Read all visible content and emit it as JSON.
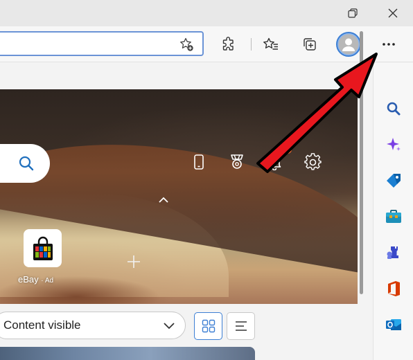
{
  "window_controls": {
    "restore": "restore-icon",
    "close": "close-icon"
  },
  "toolbar": {
    "address_value": "",
    "icons": [
      "add-favorite-icon",
      "extensions-icon",
      "favorites-icon",
      "collections-icon",
      "profile-avatar",
      "more-icon"
    ]
  },
  "hero": {
    "icons": [
      "phone-icon",
      "rewards-icon",
      "notifications-icon",
      "settings-icon"
    ],
    "tiles": [
      {
        "label": "eBay",
        "ad": "· Ad"
      }
    ]
  },
  "controls": {
    "content_select": "Content visible",
    "views": [
      "grid-view-icon",
      "list-view-icon"
    ]
  },
  "sidebar": {
    "items": [
      "search-icon",
      "copilot-icon",
      "shopping-icon",
      "tools-icon",
      "games-icon",
      "office-icon",
      "outlook-icon"
    ]
  },
  "colors": {
    "accent": "#3c7fd4",
    "annotation_arrow": "#e8171e",
    "office": "#d83b01",
    "outlook": "#0f6cbd"
  }
}
